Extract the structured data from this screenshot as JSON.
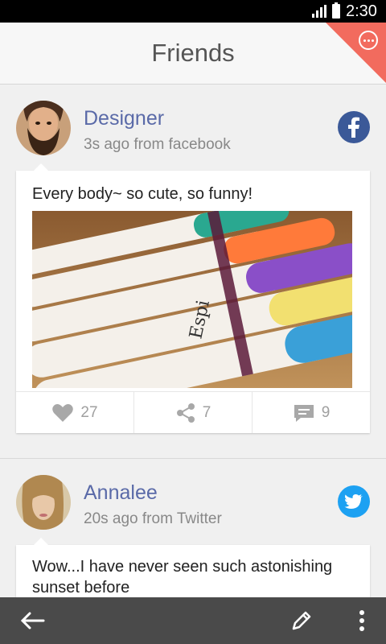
{
  "status_bar": {
    "time": "2:30"
  },
  "header": {
    "title": "Friends"
  },
  "posts": [
    {
      "author": "Designer",
      "meta": "3s ago from facebook",
      "network": "facebook-icon",
      "text": "Every body~ so cute, so funny!",
      "photo_label": "Espi",
      "likes": "27",
      "shares": "7",
      "comments": "9"
    },
    {
      "author": "Annalee",
      "meta": "20s ago from Twitter",
      "network": "twitter-icon",
      "text": "Wow...I have never seen such astonishing sunset before"
    }
  ],
  "colors": {
    "accent": "#f26b5e",
    "name": "#5a6aa8",
    "facebook": "#3b5998",
    "twitter": "#1da1f2",
    "bottom_bar": "#4a4a4a"
  }
}
